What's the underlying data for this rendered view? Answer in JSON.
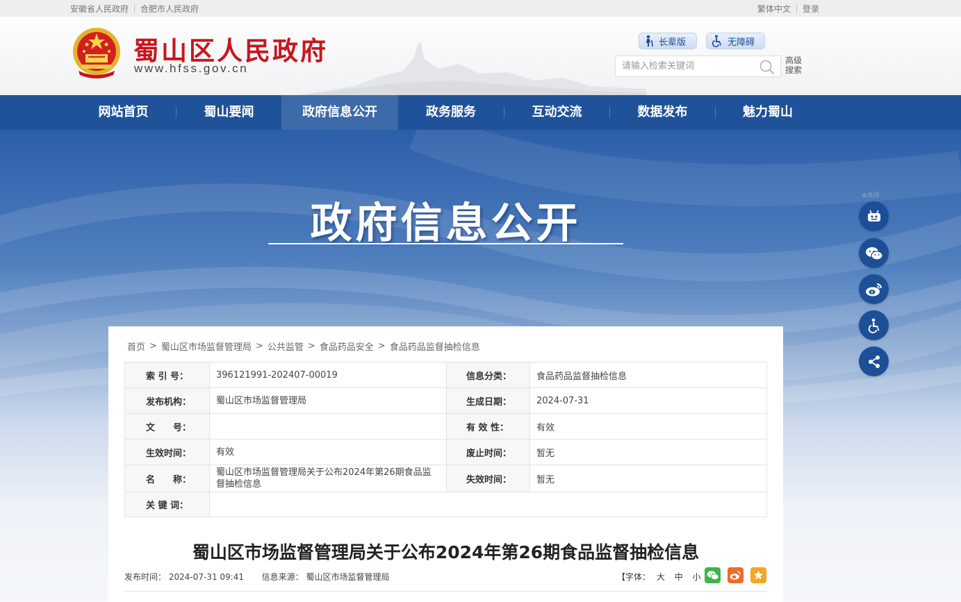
{
  "topbar": {
    "links_left": [
      "安徽省人民政府",
      "合肥市人民政府"
    ],
    "links_right": [
      "繁体中文",
      "登录"
    ]
  },
  "header": {
    "site_name": "蜀山区人民政府",
    "site_url": "www.hfss.gov.cn",
    "elder_label": "长辈版",
    "access_label": "无障碍",
    "search_placeholder": "请输入检索关键词",
    "advanced_search": "高级搜索"
  },
  "nav": {
    "items": [
      "网站首页",
      "蜀山要闻",
      "政府信息公开",
      "政务服务",
      "互动交流",
      "数据发布",
      "魅力蜀山"
    ],
    "active_index": 2
  },
  "banner": {
    "title": "政府信息公开"
  },
  "side_tools": {
    "close_label": "关闭",
    "icons": [
      "robot-icon",
      "wechat-icon",
      "weibo-icon",
      "accessibility-icon",
      "share-icon"
    ]
  },
  "breadcrumb": [
    "首页",
    "蜀山区市场监督管理局",
    "公共监管",
    "食品药品安全",
    "食品药品监督抽检信息"
  ],
  "meta_table": {
    "rows": [
      {
        "k1": "索 引 号：",
        "v1": "396121991-202407-00019",
        "k2": "信息分类：",
        "v2": "食品药品监督抽检信息"
      },
      {
        "k1": "发布机构：",
        "v1": "蜀山区市场监督管理局",
        "k2": "生成日期：",
        "v2": "2024-07-31"
      },
      {
        "k1": "文　　号：",
        "v1": "",
        "k2": "有 效 性：",
        "v2": "有效"
      },
      {
        "k1": "生效时间：",
        "v1": "有效",
        "k2": "废止时间：",
        "v2": "暂无"
      },
      {
        "k1": "名　　称：",
        "v1": "蜀山区市场监督管理局关于公布2024年第26期食品监督抽检信息",
        "k2": "失效时间：",
        "v2": "暂无"
      },
      {
        "k1": "关 键 词：",
        "v1": "",
        "k2": "",
        "v2": ""
      }
    ]
  },
  "document": {
    "title": "蜀山区市场监督管理局关于公布2024年第26期食品监督抽检信息",
    "publish_time_label": "发布时间：",
    "publish_time": "2024-07-31 09:41",
    "source_label": "信息来源：",
    "source": "蜀山区市场监督管理局",
    "font_label": "【字体：",
    "font_sizes": [
      "大",
      "中",
      "小"
    ],
    "font_close": "】"
  },
  "colors": {
    "nav_bg": "#1f5299",
    "nav_active": "#3d6aa8",
    "site_name_red": "#c8161d",
    "wechat_green": "#3fb549",
    "weibo_orange": "#ef6a2a",
    "favorite_orange": "#f5a623"
  }
}
